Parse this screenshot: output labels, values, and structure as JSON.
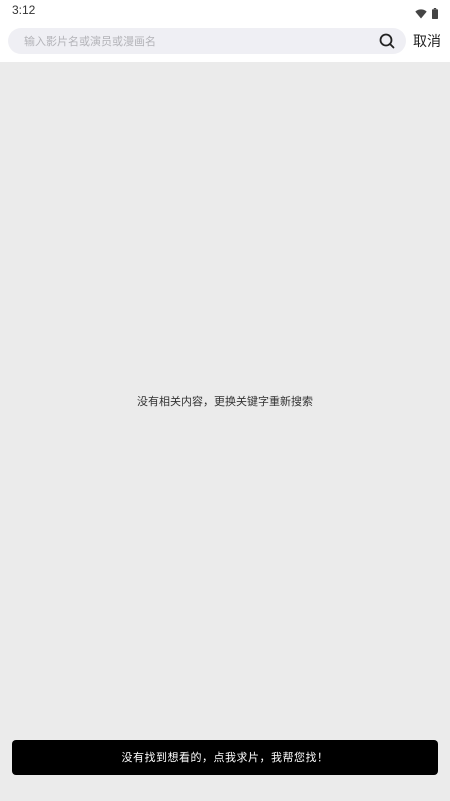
{
  "status_bar": {
    "time": "3:12",
    "icons": [
      "wifi-icon",
      "battery-icon"
    ]
  },
  "search": {
    "placeholder": "输入影片名或演员或漫画名",
    "value": "",
    "icon": "search-icon",
    "cancel_label": "取消"
  },
  "main": {
    "empty_message": "没有相关内容，更换关键字重新搜索"
  },
  "footer": {
    "request_button_label": "没有找到想看的，点我求片，我帮您找！"
  },
  "colors": {
    "background": "#ebebeb",
    "button_bg": "#000000",
    "button_text": "#ffffff"
  }
}
